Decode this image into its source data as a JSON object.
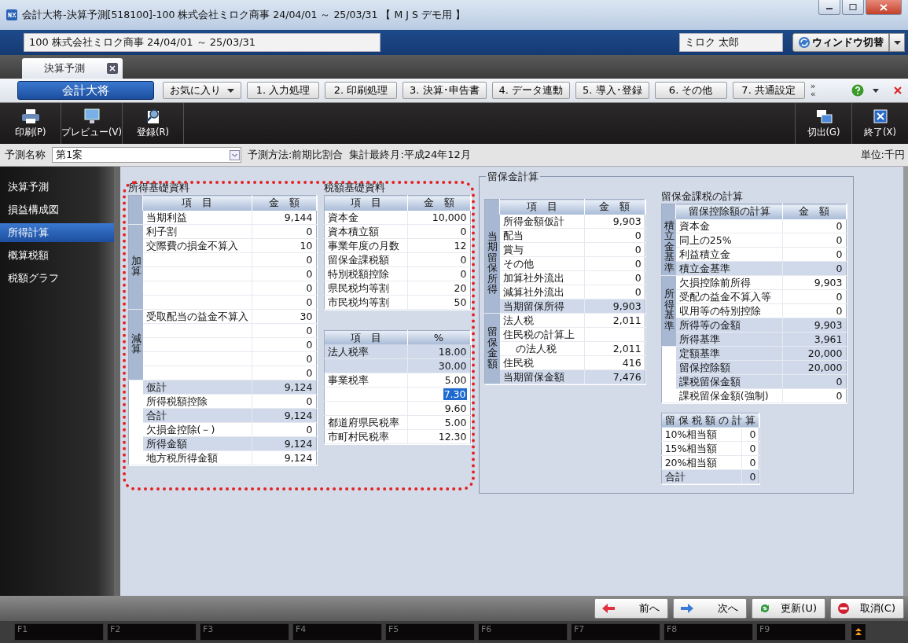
{
  "window": {
    "title": "会計大将-決算予測[518100]-100 株式会社ミロク商事 24/04/01 ～ 25/03/31 【 M J S デモ用 】"
  },
  "header": {
    "company": "100 株式会社ミロク商事 24/04/01 ～ 25/03/31",
    "user": "ミロク 太郎",
    "switch": "ウィンドウ切替"
  },
  "tabs": [
    {
      "label": "決算予測",
      "selected": true
    }
  ],
  "app_button": "会計大将",
  "menu": [
    {
      "label": "お気に入り",
      "kind": "dropdown"
    },
    {
      "label": "1. 入力処理",
      "kind": "plain"
    },
    {
      "label": "2. 印刷処理",
      "kind": "plain"
    },
    {
      "label": "3. 決算･申告書",
      "kind": "plain"
    },
    {
      "label": "4. データ連動",
      "kind": "plain"
    },
    {
      "label": "5. 導入･登録",
      "kind": "plain"
    },
    {
      "label": "6. その他",
      "kind": "plain"
    },
    {
      "label": "7. 共通設定",
      "kind": "plain"
    }
  ],
  "menu_scroll": [
    "»",
    "«"
  ],
  "toolbar_left": [
    "印刷(P)",
    "プレビュー(V)",
    "登録(R)"
  ],
  "toolbar_right": [
    "切出(G)",
    "終了(X)"
  ],
  "filter": {
    "label": "予測名称",
    "value": "第1案",
    "method": "予測方法:前期比割合",
    "last_month": "集計最終月:平成24年12月",
    "unit": "単位:千円"
  },
  "sidebar": [
    {
      "label": "決算予測",
      "selected": false
    },
    {
      "label": "損益構成図",
      "selected": false
    },
    {
      "label": "所得計算",
      "selected": true
    },
    {
      "label": "概算税額",
      "selected": false
    },
    {
      "label": "税額グラフ",
      "selected": false
    }
  ],
  "income_basis": {
    "title": "所得基礎資料",
    "columns": [
      "項　目",
      "金　額"
    ],
    "groups": [
      {
        "band": true,
        "rows": [
          {
            "label": "当期利益",
            "value": "9,144",
            "shaded": false
          }
        ]
      },
      {
        "band": true,
        "label": "加算",
        "rows": [
          {
            "label": "利子割",
            "value": "0",
            "shaded": false
          },
          {
            "label": "交際費の損金不算入",
            "value": "10",
            "shaded": false
          },
          {
            "value": "0",
            "shaded": false
          },
          {
            "value": "0",
            "shaded": false
          },
          {
            "value": "0",
            "shaded": false
          },
          {
            "value": "0",
            "shaded": false
          }
        ]
      },
      {
        "band": true,
        "label": "減算",
        "rows": [
          {
            "label": "受取配当の益金不算入",
            "value": "30",
            "shaded": false
          },
          {
            "value": "0",
            "shaded": false
          },
          {
            "value": "0",
            "shaded": false
          },
          {
            "value": "0",
            "shaded": false
          },
          {
            "value": "0",
            "shaded": false
          }
        ]
      },
      {
        "band": false,
        "rows": [
          {
            "label": "仮計",
            "value": "9,124",
            "shaded": true
          },
          {
            "label": "所得税額控除",
            "value": "0",
            "shaded": false
          },
          {
            "label": "合計",
            "value": "9,124",
            "shaded": true
          },
          {
            "label": "欠損金控除(－)",
            "value": "0",
            "shaded": false
          },
          {
            "label": "所得金額",
            "value": "9,124",
            "shaded": true
          },
          {
            "label": "地方税所得金額",
            "value": "9,124",
            "shaded": false
          }
        ]
      }
    ]
  },
  "tax_basis": {
    "title": "税額基礎資料",
    "columns": [
      "項　目",
      "金　額"
    ],
    "rows": [
      {
        "label": "資本金",
        "value": "10,000",
        "shaded": false
      },
      {
        "label": "資本積立額",
        "value": "0",
        "shaded": false
      },
      {
        "label": "事業年度の月数",
        "value": "12",
        "shaded": false
      },
      {
        "label": "留保金課税額",
        "value": "0",
        "shaded": false
      },
      {
        "label": "特別税額控除",
        "value": "0",
        "shaded": false
      },
      {
        "label": "県民税均等割",
        "value": "20",
        "shaded": false
      },
      {
        "label": "市民税均等割",
        "value": "50",
        "shaded": false
      }
    ]
  },
  "tax_rates": {
    "columns": [
      "項　目",
      "%"
    ],
    "rows": [
      {
        "label": "法人税率",
        "value": "18.00",
        "shaded": true,
        "selected": false
      },
      {
        "value": "30.00",
        "shaded": true,
        "selected": false
      },
      {
        "label": "事業税率",
        "value": "5.00",
        "shaded": false,
        "selected": false
      },
      {
        "value": "7.30",
        "shaded": false,
        "selected": true
      },
      {
        "value": "9.60",
        "shaded": false,
        "selected": false
      },
      {
        "label": "都道府県民税率",
        "value": "5.00",
        "shaded": false,
        "selected": false
      },
      {
        "label": "市町村民税率",
        "value": "12.30",
        "shaded": false,
        "selected": false
      }
    ]
  },
  "retained": {
    "title": "留保金計算",
    "calc": {
      "columns": [
        "項　目",
        "金　額"
      ],
      "groups": [
        {
          "band": true,
          "label": "当期留保所得",
          "rows": [
            {
              "label": "所得金額仮計",
              "value": "9,903",
              "shaded": false
            },
            {
              "label": "配当",
              "value": "0",
              "shaded": false
            },
            {
              "label": "賞与",
              "value": "0",
              "shaded": false
            },
            {
              "label": "その他",
              "value": "0",
              "shaded": false
            },
            {
              "label": "加算社外流出",
              "value": "0",
              "shaded": false
            },
            {
              "label": "減算社外流出",
              "value": "0",
              "shaded": false
            },
            {
              "label": "当期留保所得",
              "value": "9,903",
              "shaded": true
            }
          ]
        },
        {
          "band": true,
          "label": "留保金額",
          "rows": [
            {
              "label": "法人税",
              "value": "2,011",
              "shaded": false
            },
            {
              "label": "住民税の計算上",
              "shaded": false
            },
            {
              "label": "の法人税",
              "value": "2,011",
              "shaded": false,
              "indent": true
            },
            {
              "label": "住民税",
              "value": "416",
              "shaded": false
            },
            {
              "label": "当期留保金額",
              "value": "7,476",
              "shaded": true
            }
          ]
        }
      ]
    },
    "taxation": {
      "title": "留保金課税の計算",
      "columns": [
        "留保控除額の計算",
        "金　額"
      ],
      "groups": [
        {
          "band": true,
          "label": "積立金基準",
          "rows": [
            {
              "label": "資本金",
              "value": "0",
              "shaded": false
            },
            {
              "label": "同上の25%",
              "value": "0",
              "shaded": false
            },
            {
              "label": "利益積立金",
              "value": "0",
              "shaded": false
            },
            {
              "label": "積立金基準",
              "value": "0",
              "shaded": true
            }
          ]
        },
        {
          "band": true,
          "label": "所得基準",
          "rows": [
            {
              "label": "欠損控除前所得",
              "value": "9,903",
              "shaded": false
            },
            {
              "label": "受配の益金不算入等",
              "value": "0",
              "shaded": false
            },
            {
              "label": "収用等の特別控除",
              "value": "0",
              "shaded": false
            },
            {
              "label": "所得等の金額",
              "value": "9,903",
              "shaded": true
            },
            {
              "label": "所得基準",
              "value": "3,961",
              "shaded": true
            }
          ]
        },
        {
          "band": false,
          "rows": [
            {
              "label": "定額基準",
              "value": "20,000",
              "shaded": true
            },
            {
              "label": "留保控除額",
              "value": "20,000",
              "shaded": true
            },
            {
              "label": "課税留保金額",
              "value": "0",
              "shaded": true
            },
            {
              "label": "課税留保金額(強制)",
              "value": "0",
              "shaded": false
            }
          ]
        }
      ]
    },
    "amount": {
      "columns": [
        "留 保 税 額 の 計 算"
      ],
      "rows": [
        {
          "label": "10%相当額",
          "value": "0",
          "shaded": false
        },
        {
          "label": "15%相当額",
          "value": "0",
          "shaded": false
        },
        {
          "label": "20%相当額",
          "value": "0",
          "shaded": false
        },
        {
          "label": "合計",
          "value": "0",
          "shaded": true
        }
      ]
    }
  },
  "bottom_buttons": [
    "前へ",
    "次へ",
    "更新(U)",
    "取消(C)"
  ],
  "function_keys": [
    "F1",
    "F2",
    "F3",
    "F4",
    "F5",
    "F6",
    "F7",
    "F8",
    "F9"
  ]
}
